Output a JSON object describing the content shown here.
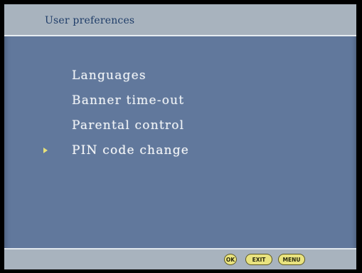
{
  "header": {
    "title": "User preferences"
  },
  "menu": {
    "items": [
      {
        "label": "Languages",
        "selected": false
      },
      {
        "label": "Banner time-out",
        "selected": false
      },
      {
        "label": "Parental control",
        "selected": false
      },
      {
        "label": "PIN code change",
        "selected": true
      }
    ]
  },
  "footer": {
    "ok_label": "OK",
    "exit_label": "EXIT",
    "menu_label": "MENU"
  },
  "colors": {
    "background": "#61789c",
    "bar": "#a8b3be",
    "title_text": "#1e3c68",
    "menu_text": "#eef2f6",
    "selection_arrow": "#e8e27a",
    "button": "#e9e37f"
  },
  "icons": {
    "selection": "selection-arrow-icon"
  }
}
